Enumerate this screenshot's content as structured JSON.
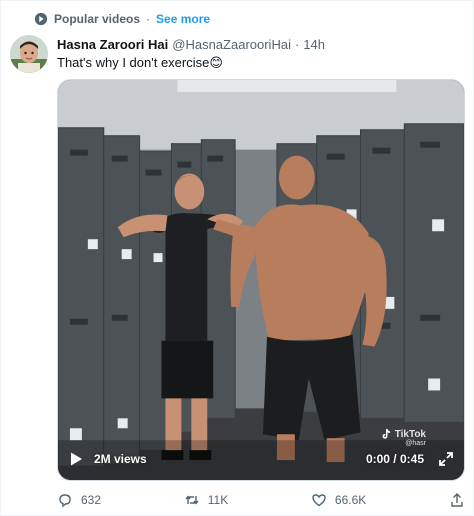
{
  "context": {
    "label": "Popular videos",
    "separator": "·",
    "see_more": "See more"
  },
  "tweet": {
    "author_name": "Hasna Zaroori Hai",
    "author_handle": "@HasnaZaarooriHai",
    "separator": "·",
    "time": "14h",
    "text": "That's why I don't exercise😊"
  },
  "video": {
    "views": "2M views",
    "time_display": "0:00 / 0:45",
    "watermark": "TikTok",
    "watermark_sub": "@hasr"
  },
  "actions": {
    "replies": "632",
    "retweets": "11K",
    "likes": "66.6K"
  },
  "colors": {
    "accent": "#1d9bf0",
    "muted": "#536471",
    "text": "#0f1419"
  }
}
